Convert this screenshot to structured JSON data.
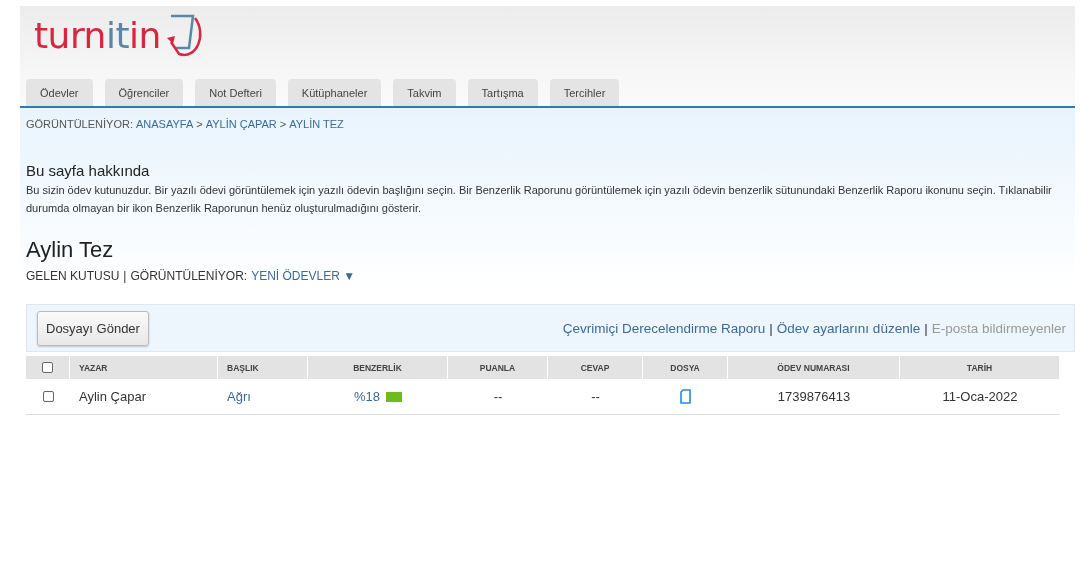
{
  "logo": {
    "parts": [
      {
        "text": "turn",
        "color": "#d7263d"
      },
      {
        "text": "it",
        "color": "#5b87a6"
      },
      {
        "text": "in",
        "color": "#d7263d"
      }
    ]
  },
  "tabs": [
    {
      "label": "Ödevler",
      "selected": false
    },
    {
      "label": "Öğrenciler",
      "selected": false
    },
    {
      "label": "Not Defteri",
      "selected": false
    },
    {
      "label": "Kütüphaneler",
      "selected": false
    },
    {
      "label": "Takvim",
      "selected": false
    },
    {
      "label": "Tartışma",
      "selected": false
    },
    {
      "label": "Tercihler",
      "selected": false
    }
  ],
  "breadcrumb": {
    "label": "GÖRÜNTÜLENİYOR:",
    "links": [
      "ANASAYFA",
      "AYLİN ÇAPAR",
      "AYLİN TEZ"
    ],
    "separator": ">"
  },
  "about": {
    "title": "Bu sayfa hakkında",
    "text": "Bu sizin ödev kutunuzdur. Bir yazılı ödevi görüntülemek için yazılı ödevin başlığını seçin. Bir Benzerlik Raporunu görüntülemek için yazılı ödevin benzerlik sütunundaki Benzerlik Raporu ikonunu seçin. Tıklanabilir durumda olmayan bir ikon Benzerlik Raporunun henüz oluşturulmadığını gösterir."
  },
  "assignment": {
    "title": "Aylin Tez",
    "inbox": "GELEN KUTUSU",
    "separator": "|",
    "viewing_label": "GÖRÜNTÜLENİYOR:",
    "viewing_value": "YENİ ÖDEVLER",
    "caret": "▼"
  },
  "toolbar": {
    "submit_button": "Dosyayı Gönder",
    "links": [
      {
        "label": "Çevrimiçi Derecelendirme Raporu",
        "disabled": false
      },
      {
        "label": "Ödev ayarlarını düzenle",
        "disabled": false
      },
      {
        "label": "E-posta bildirmeyenler",
        "disabled": true
      }
    ],
    "separator": "|"
  },
  "table": {
    "columns": [
      "YAZAR",
      "BAŞLIK",
      "BENZERLİK",
      "PUANLA",
      "CEVAP",
      "DOSYA",
      "ÖDEV NUMARASI",
      "TARİH"
    ],
    "header_checked": false,
    "rows": [
      {
        "checked": false,
        "author": "Aylin Çapar",
        "title": "Ağrı",
        "similarity": "%18",
        "color": "#6fba1c",
        "grade": "--",
        "response": "--",
        "paper_id": "1739876413",
        "date": "11-Oca-2022"
      }
    ]
  }
}
